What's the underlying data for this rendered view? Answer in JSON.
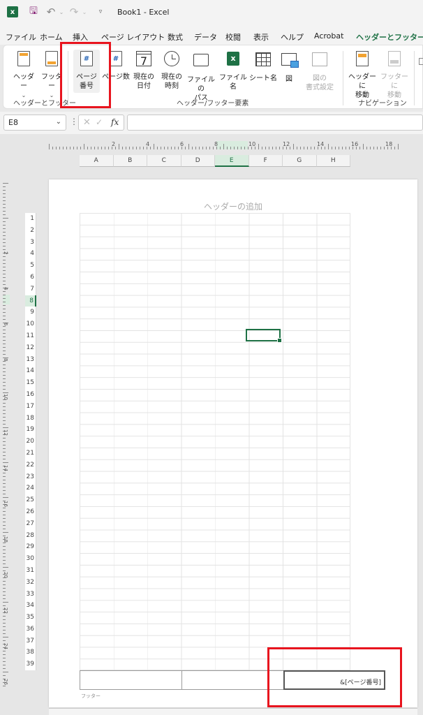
{
  "titlebar": {
    "app_icon": "excel-logo-icon",
    "logo_text": "x",
    "doc_title": "Book1  -  Excel"
  },
  "tabs": [
    "ファイル",
    "ホーム",
    "挿入",
    "ページ レイアウト",
    "数式",
    "データ",
    "校閲",
    "表示",
    "ヘルプ",
    "Acrobat",
    "ヘッダーとフッター"
  ],
  "ribbon": {
    "header_label": "ヘッダー",
    "footer_label": "フッター",
    "page_number_label_1": "ページ",
    "page_number_label_2": "番号",
    "page_count_label": "ページ数",
    "current_date_label_1": "現在の",
    "current_date_label_2": "日付",
    "current_time_label_1": "現在の",
    "current_time_label_2": "時刻",
    "file_path_label_1": "ファイルの",
    "file_path_label_2": "パス",
    "file_name_label": "ファイル名",
    "sheet_name_label": "シート名",
    "picture_label": "図",
    "format_picture_label_1": "図の",
    "format_picture_label_2": "書式設定",
    "goto_header_label_1": "ヘッダーに",
    "goto_header_label_2": "移動",
    "goto_footer_label_1": "フッターに",
    "goto_footer_label_2": "移動",
    "group_header_footer": "ヘッダーとフッター",
    "group_elements": "ヘッダー/フッター要素",
    "group_navigation": "ナビゲーション",
    "calendar_glyph": "7",
    "hash_glyph": "#",
    "excel_glyph": "x"
  },
  "formula_bar": {
    "name_box": "E8",
    "fx_label": "fx",
    "formula": ""
  },
  "ruler": {
    "numbers": [
      "2",
      "4",
      "6",
      "8",
      "10",
      "12",
      "14",
      "16",
      "18"
    ],
    "v_numbers": [
      "2",
      "4",
      "6",
      "8",
      "10",
      "12",
      "14",
      "16",
      "18",
      "20",
      "22",
      "24",
      "26"
    ]
  },
  "columns": [
    "A",
    "B",
    "C",
    "D",
    "E",
    "F",
    "G",
    "H"
  ],
  "selected_column": "E",
  "rows": [
    "1",
    "2",
    "3",
    "4",
    "5",
    "6",
    "7",
    "8",
    "9",
    "10",
    "11",
    "12",
    "13",
    "14",
    "15",
    "16",
    "17",
    "18",
    "19",
    "20",
    "21",
    "22",
    "23",
    "24",
    "25",
    "26",
    "27",
    "28",
    "29",
    "30",
    "31",
    "32",
    "33",
    "34",
    "35",
    "36",
    "37",
    "38",
    "39"
  ],
  "selected_row": "8",
  "page": {
    "header_placeholder": "ヘッダーの追加",
    "footer_right_text": "&[ページ番号]",
    "footer_label": "フッター"
  },
  "colors": {
    "accent": "#1e7145",
    "highlight_box": "#e8141e"
  }
}
